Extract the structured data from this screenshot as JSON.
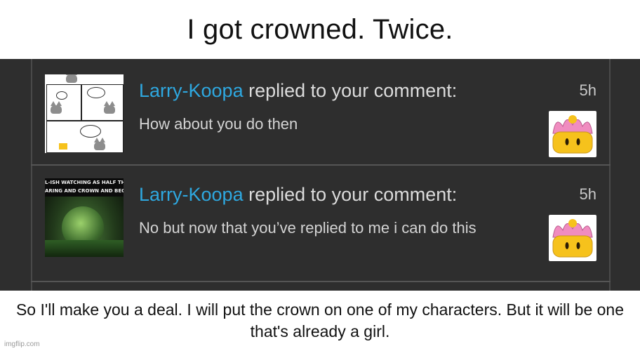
{
  "top_caption": "I got crowned. Twice.",
  "bottom_caption": "So I'll make you a deal. I will put the crown on one of my characters. But it will be one that's already a girl.",
  "watermark": "imgflip.com",
  "notifications": [
    {
      "username": "Larry-Koopa",
      "action": " replied to your comment:",
      "time": "5h",
      "comment": "How about you do then",
      "thumbnail_icon": "comic-thumbnail",
      "badge_icon": "super-crown-icon"
    },
    {
      "username": "Larry-Koopa",
      "action": " replied to your comment:",
      "time": "5h",
      "comment": "No but now that you’ve replied to me i can do this",
      "thumbnail_icon": "video-thumbnail",
      "thumbnail_caption": "L-ISH WATCHING AS HALF THE S\nARING AND CROWN AND BECOM",
      "badge_icon": "super-crown-icon"
    }
  ],
  "colors": {
    "panel_background": "#2e2e2e",
    "username": "#2ea8e0",
    "text": "#d4d4d4",
    "crown_yellow": "#f6c21c",
    "crown_pink": "#f08cc0"
  }
}
